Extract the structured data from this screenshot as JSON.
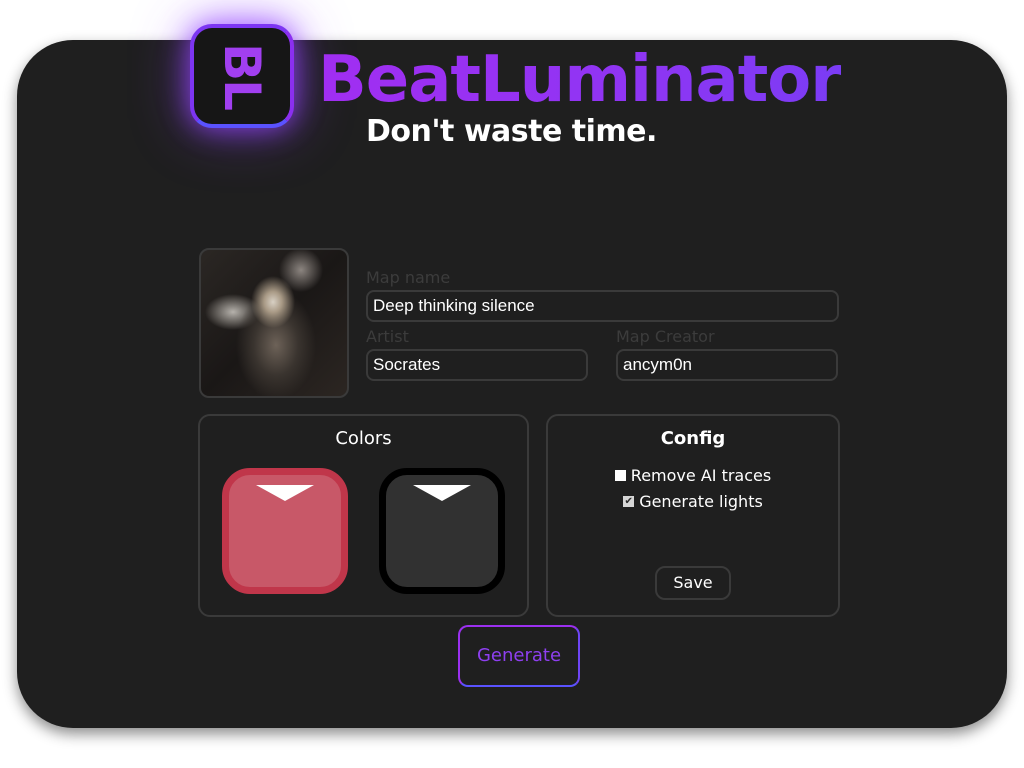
{
  "app": {
    "name": "BeatLuminator",
    "logo_text": "BL",
    "tagline": "Don't waste time."
  },
  "map": {
    "name_label": "Map name",
    "name_value": "Deep thinking silence",
    "artist_label": "Artist",
    "artist_value": "Socrates",
    "creator_label": "Map Creator",
    "creator_value": "ancym0n"
  },
  "colors_panel": {
    "title": "Colors",
    "left_color": "#c85868",
    "left_border": "#c0364a",
    "right_color": "#313131",
    "right_border": "#000000"
  },
  "config_panel": {
    "title": "Config",
    "options": [
      {
        "label": "Remove AI traces",
        "checked": false
      },
      {
        "label": "Generate lights",
        "checked": true
      }
    ],
    "save_label": "Save"
  },
  "actions": {
    "generate_label": "Generate"
  },
  "theme": {
    "accent": "#9a2ff0",
    "accent_blue": "#5a52ff",
    "background": "#1f1f1f",
    "border": "#3a3a3a"
  }
}
